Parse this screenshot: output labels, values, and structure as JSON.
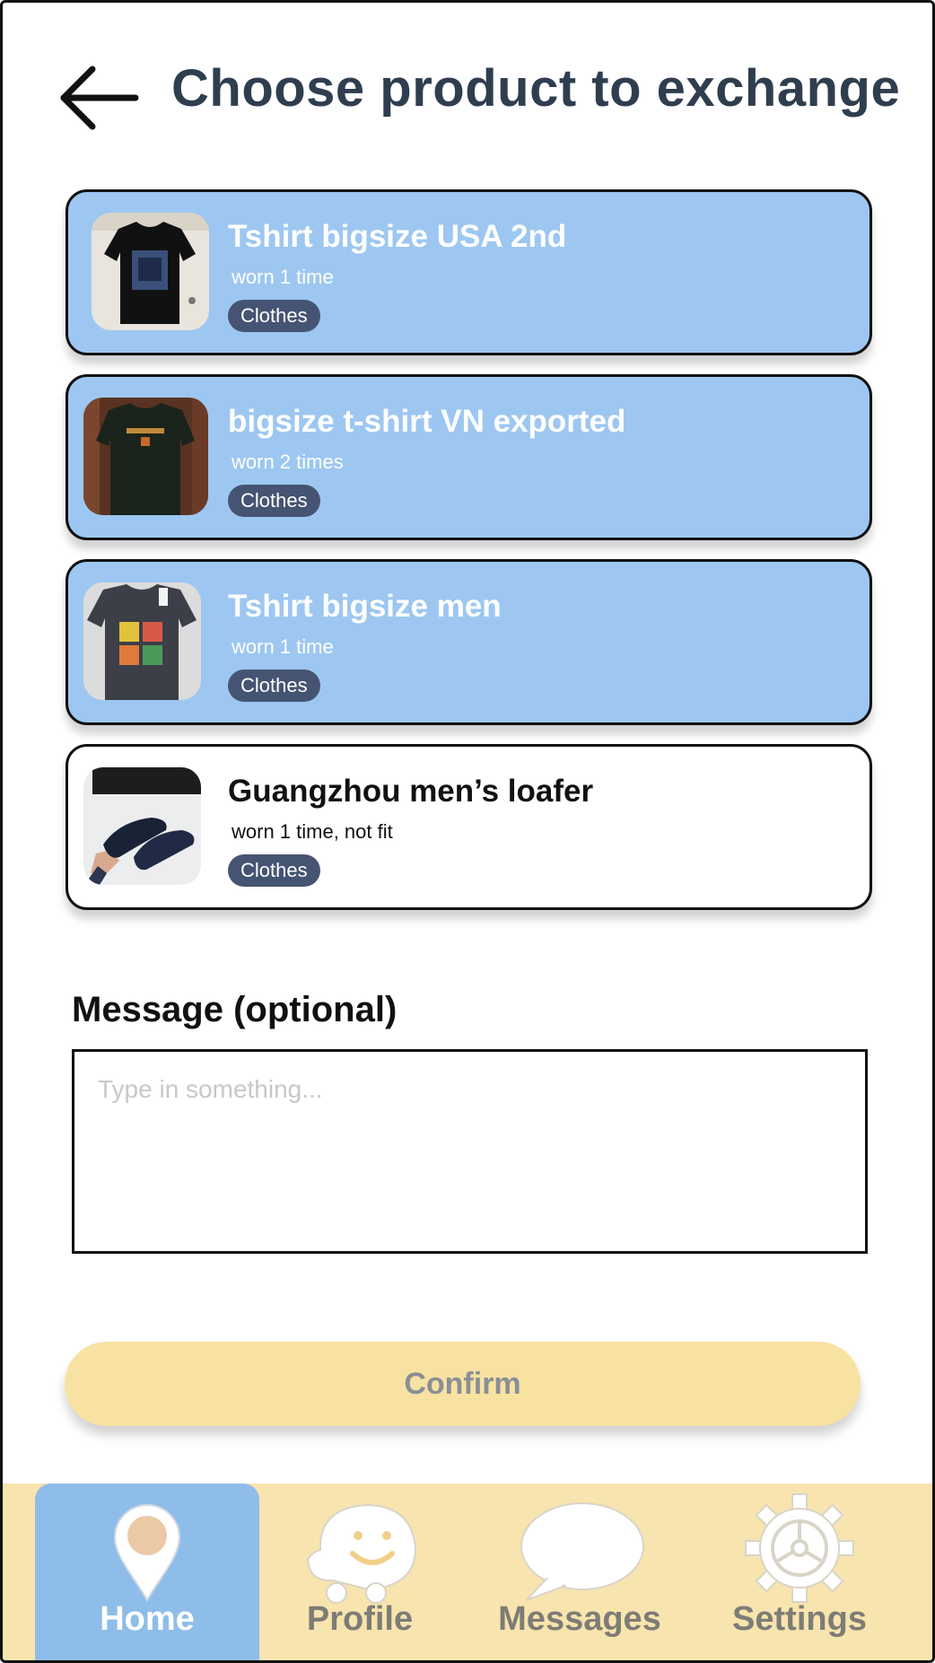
{
  "header": {
    "title": "Choose product to exchange"
  },
  "products": [
    {
      "name": "Tshirt bigsize USA 2nd",
      "condition": "worn 1 time",
      "category": "Clothes",
      "selected": true
    },
    {
      "name": "bigsize t-shirt VN exported",
      "condition": "worn 2 times",
      "category": "Clothes",
      "selected": true
    },
    {
      "name": "Tshirt bigsize men",
      "condition": "worn 1 time",
      "category": "Clothes",
      "selected": true
    },
    {
      "name": "Guangzhou men’s loafer",
      "condition": "worn 1 time, not fit",
      "category": "Clothes",
      "selected": false
    }
  ],
  "message": {
    "label": "Message (optional)",
    "placeholder": "Type in something...",
    "value": ""
  },
  "confirm_label": "Confirm",
  "nav": {
    "items": [
      {
        "label": "Home",
        "icon": "map-pin-icon",
        "active": true
      },
      {
        "label": "Profile",
        "icon": "smiley-icon",
        "active": false
      },
      {
        "label": "Messages",
        "icon": "speech-bubble-icon",
        "active": false
      },
      {
        "label": "Settings",
        "icon": "gear-icon",
        "active": false
      }
    ]
  },
  "colors": {
    "selected_card": "#9dc7f1",
    "tag": "#465473",
    "confirm": "#f8e2a2",
    "nav_bar": "#f8e4ae",
    "nav_active": "#8fbde9",
    "title": "#2f3e4f"
  }
}
